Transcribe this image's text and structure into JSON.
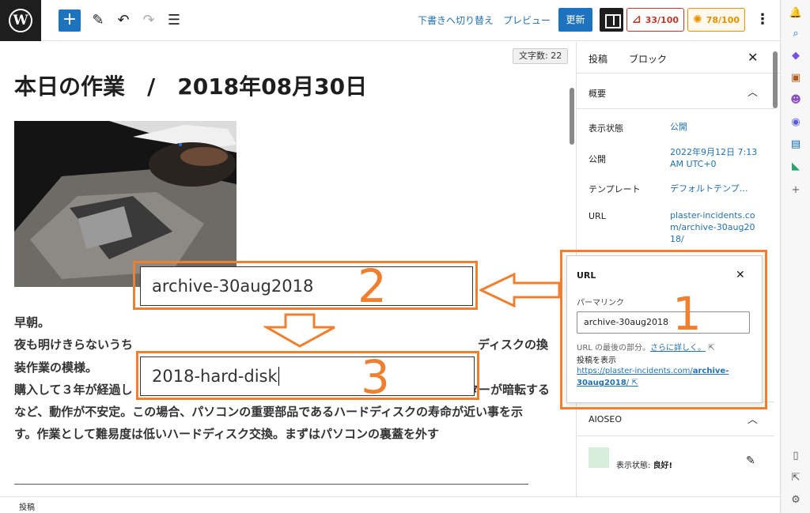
{
  "toolbar": {
    "switch_to_draft": "下書きへ切り替え",
    "preview": "プレビュー",
    "update": "更新",
    "seo_score": "33/100",
    "readability_score": "78/100"
  },
  "editor": {
    "word_count": "文字数: 22",
    "title": "本日の作業　/　2018年08月30日",
    "paragraphs": [
      "早朝。",
      "夜も明けきらないうち",
      "ディスクの換",
      "装作業の模様。",
      "購入して３年が経過し",
      "ターが暗転する",
      "など、動作が不安定。この場合、パソコンの重要部品であるハードディスクの寿命が近い事を示",
      "す。作業として難易度は低いハードディスク交換。まずはパソコンの裏蓋を外す"
    ]
  },
  "sidebar": {
    "tabs": [
      "投稿",
      "ブロック"
    ],
    "summary_title": "概要",
    "rows": [
      {
        "label": "表示状態",
        "value": "公開"
      },
      {
        "label": "公開",
        "value": "2022年9月12日 7:13 AM UTC+0"
      },
      {
        "label": "テンプレート",
        "value": "デフォルトテンプ…"
      },
      {
        "label": "URL",
        "value": "plaster-incidents.com/archive-30aug2018/"
      }
    ],
    "aioseo_title": "AIOSEO",
    "aioseo_status_label": "表示状態:",
    "aioseo_status_value": "良好!"
  },
  "url_popover": {
    "title": "URL",
    "permalink_label": "パーマリンク",
    "slug_value": "archive-30aug2018",
    "help_text": "URL の最後の部分。",
    "help_link": "さらに詳しく。",
    "view_post_label": "投稿を表示",
    "post_url_prefix": "https://plaster-incidents.com/",
    "post_url_slug": "archive-30aug2018",
    "post_url_suffix": "/"
  },
  "annotations": {
    "before_slug": "archive-30aug2018",
    "after_slug": "2018-hard-disk",
    "step1": "1",
    "step2": "2",
    "step3": "3",
    "accent_color": "#f08030"
  },
  "statusbar": {
    "label": "投稿"
  }
}
